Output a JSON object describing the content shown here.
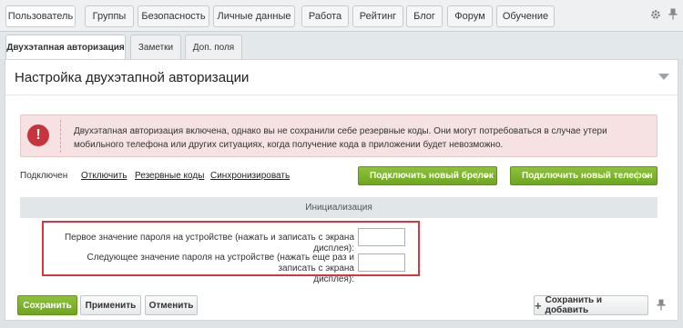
{
  "top_tabs": [
    {
      "label": "Пользователь",
      "name": "tab-user"
    },
    {
      "label": "Группы",
      "name": "tab-groups"
    },
    {
      "label": "Безопасность",
      "name": "tab-security"
    },
    {
      "label": "Личные данные",
      "name": "tab-personal"
    },
    {
      "label": "Работа",
      "name": "tab-work"
    },
    {
      "label": "Рейтинг",
      "name": "tab-rating"
    },
    {
      "label": "Блог",
      "name": "tab-blog"
    },
    {
      "label": "Форум",
      "name": "tab-forum"
    },
    {
      "label": "Обучение",
      "name": "tab-learning"
    }
  ],
  "sub_tabs": [
    {
      "label": "Двухэтапная авторизация",
      "name": "subtab-2fa"
    },
    {
      "label": "Заметки",
      "name": "subtab-notes"
    },
    {
      "label": "Доп. поля",
      "name": "subtab-extra-fields"
    }
  ],
  "panel": {
    "title": "Настройка двухэтапной авторизации"
  },
  "alert": {
    "icon_symbol": "!",
    "text": "Двухэтапная авторизация включена, однако вы не сохранили себе резервные коды. Они могут потребоваться в случае утери мобильного телефона или других ситуациях, когда получение кода в приложении будет невозможно."
  },
  "status_row": {
    "status": "Подключен",
    "disable_link": "Отключить",
    "backup_codes_link": "Резервные коды",
    "sync_link": "Синхронизировать",
    "new_keyfob_button": "Подключить новый брелок",
    "new_phone_button": "Подключить новый телефон"
  },
  "init": {
    "header": "Инициализация",
    "first_label": "Первое значение пароля на устройстве (нажать и записать с экрана дисплея):",
    "second_label_line1": "Следующее значение пароля на устройстве (нажать еще раз и записать с экрана",
    "second_label_line2": "дисплея):",
    "first_value": "",
    "second_value": ""
  },
  "footer": {
    "save": "Сохранить",
    "apply": "Применить",
    "cancel": "Отменить",
    "save_and_add": "Сохранить и добавить"
  },
  "colors": {
    "accent_green": "#7db52c",
    "alert_bg": "#f6e2e3",
    "alert_icon": "#c8343b",
    "highlight_red": "#d9363e"
  }
}
